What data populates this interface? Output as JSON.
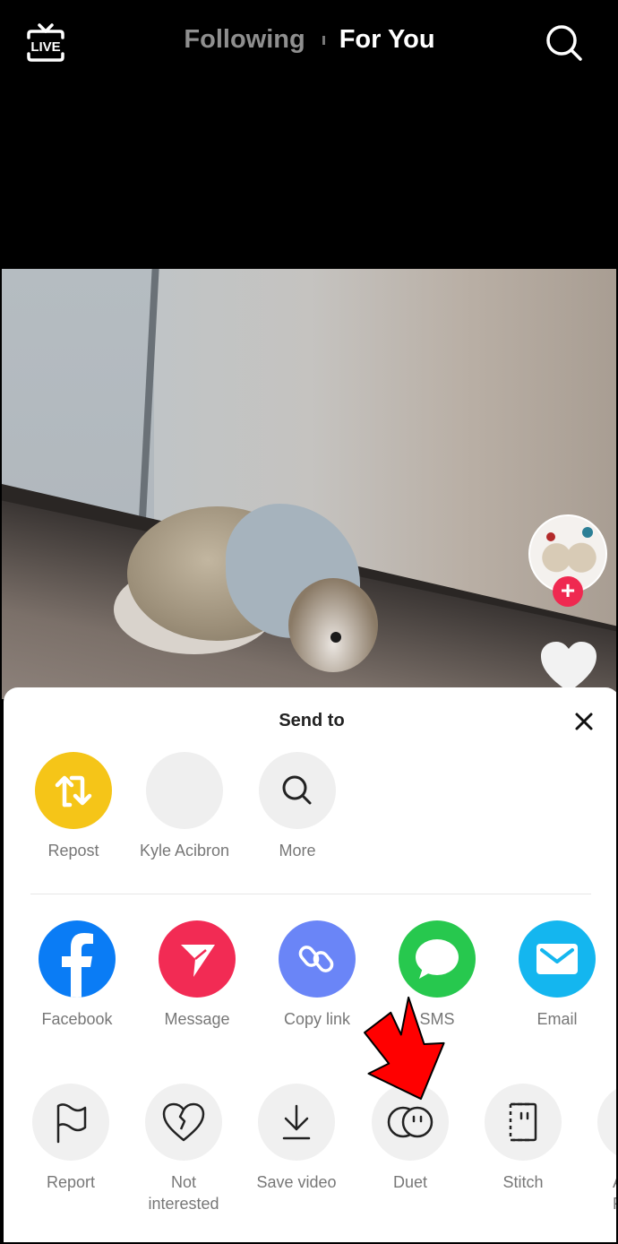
{
  "top_nav": {
    "live_label": "LIVE",
    "tabs": [
      {
        "label": "Following",
        "active": false
      },
      {
        "label": "For You",
        "active": true
      }
    ],
    "search_icon": "search-icon"
  },
  "video": {
    "description": "Hedgehog wearing a shark costume",
    "creator_avatar": "two hedgehogs with hats",
    "follow_icon": "plus-icon",
    "like_icon": "heart-icon"
  },
  "share_sheet": {
    "title": "Send to",
    "close_icon": "close-icon",
    "contacts": [
      {
        "label": "Repost",
        "icon": "repost-icon",
        "color": "#f5c518"
      },
      {
        "label": "Kyle Acibron",
        "icon": "avatar-placeholder",
        "color": "#efefef"
      },
      {
        "label": "More",
        "icon": "search-icon",
        "color": "#efefef"
      }
    ],
    "share_apps": [
      {
        "label": "Facebook",
        "icon": "facebook-icon",
        "color": "#0a7cf5"
      },
      {
        "label": "Message",
        "icon": "send-icon",
        "color": "#f22b54"
      },
      {
        "label": "Copy link",
        "icon": "link-icon",
        "color": "#6a85f7"
      },
      {
        "label": "SMS",
        "icon": "chat-bubble-icon",
        "color": "#27c84e"
      },
      {
        "label": "Email",
        "icon": "envelope-icon",
        "color": "#14b6ef"
      }
    ],
    "actions": [
      {
        "label": "Report",
        "icon": "flag-icon"
      },
      {
        "label": "Not\ninterested",
        "label_line1": "Not",
        "label_line2": "interested",
        "icon": "broken-heart-icon"
      },
      {
        "label": "Save video",
        "icon": "download-icon"
      },
      {
        "label": "Duet",
        "icon": "duet-icon"
      },
      {
        "label": "Stitch",
        "icon": "stitch-icon"
      },
      {
        "label_line1": "A",
        "label_line2": "Fa",
        "icon": "partial-action-icon"
      }
    ],
    "annotation": {
      "type": "red-arrow",
      "points_to": "Duet",
      "color": "#ff0000"
    }
  }
}
